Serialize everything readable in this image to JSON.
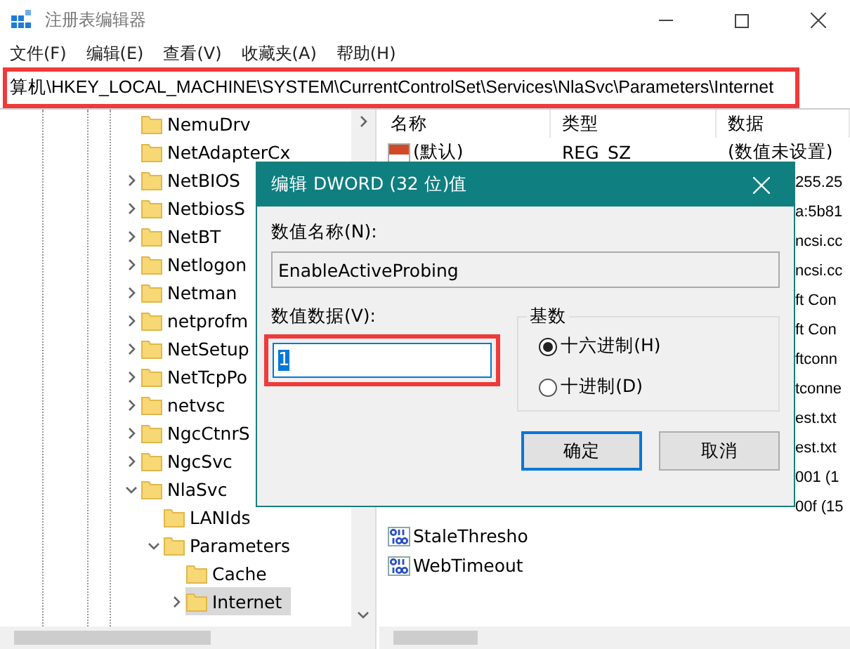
{
  "window": {
    "title": "注册表编辑器"
  },
  "menu": [
    "文件(F)",
    "编辑(E)",
    "查看(V)",
    "收藏夹(A)",
    "帮助(H)"
  ],
  "address": "算机\\HKEY_LOCAL_MACHINE\\SYSTEM\\CurrentControlSet\\Services\\NlaSvc\\Parameters\\Internet",
  "tree": [
    {
      "label": "NemuDrv",
      "kind": "leaf",
      "selected": false
    },
    {
      "label": "NetAdapterCx",
      "kind": "leaf",
      "selected": false
    },
    {
      "label": "NetBIOS",
      "kind": "branch",
      "expanded": false,
      "selected": false
    },
    {
      "label": "NetbiosS",
      "kind": "branch",
      "expanded": false,
      "selected": false
    },
    {
      "label": "NetBT",
      "kind": "branch",
      "expanded": false,
      "selected": false
    },
    {
      "label": "Netlogon",
      "kind": "branch",
      "expanded": false,
      "selected": false
    },
    {
      "label": "Netman",
      "kind": "branch",
      "expanded": false,
      "selected": false
    },
    {
      "label": "netprofm",
      "kind": "branch",
      "expanded": false,
      "selected": false
    },
    {
      "label": "NetSetup",
      "kind": "branch",
      "expanded": false,
      "selected": false
    },
    {
      "label": "NetTcpPo",
      "kind": "branch",
      "expanded": false,
      "selected": false
    },
    {
      "label": "netvsc",
      "kind": "branch",
      "expanded": false,
      "selected": false
    },
    {
      "label": "NgcCtnrS",
      "kind": "branch",
      "expanded": false,
      "selected": false
    },
    {
      "label": "NgcSvc",
      "kind": "branch",
      "expanded": false,
      "selected": false
    },
    {
      "label": "NlaSvc",
      "kind": "branch",
      "expanded": true,
      "selected": false,
      "children": [
        {
          "label": "LANIds",
          "kind": "leaf",
          "selected": false
        },
        {
          "label": "Parameters",
          "kind": "branch",
          "expanded": true,
          "selected": false,
          "children": [
            {
              "label": "Cache",
              "kind": "leaf",
              "selected": false
            },
            {
              "label": "Internet",
              "kind": "branch",
              "expanded": false,
              "selected": true
            }
          ]
        }
      ]
    }
  ],
  "columns": [
    "名称",
    "类型",
    "数据"
  ],
  "values": [
    {
      "kind": "string",
      "name": "(默认)",
      "type": "REG_SZ",
      "data": "(数值未设置)"
    },
    {
      "kind": "partial",
      "data": "255.25"
    },
    {
      "kind": "partial",
      "data": "a:5b81"
    },
    {
      "kind": "partial",
      "data": "ncsi.cc"
    },
    {
      "kind": "partial",
      "data": "ncsi.cc"
    },
    {
      "kind": "partial",
      "data": "ft Con"
    },
    {
      "kind": "partial",
      "data": "ft Con"
    },
    {
      "kind": "partial",
      "data": "ftconn"
    },
    {
      "kind": "partial",
      "data": "tconne"
    },
    {
      "kind": "partial",
      "data": "est.txt"
    },
    {
      "kind": "partial",
      "data": "est.txt"
    },
    {
      "kind": "partial",
      "data": "001 (1"
    },
    {
      "kind": "partial",
      "data": "00f (15"
    },
    {
      "kind": "binary",
      "name": "StaleThresho"
    },
    {
      "kind": "binary",
      "name": "WebTimeout"
    }
  ],
  "dialog": {
    "title": "编辑 DWORD (32 位)值",
    "name_label": "数值名称(N):",
    "name_value": "EnableActiveProbing",
    "data_label": "数值数据(V):",
    "data_value": "1",
    "base_label": "基数",
    "radios": [
      {
        "label": "十六进制(H)",
        "selected": true
      },
      {
        "label": "十进制(D)",
        "selected": false
      }
    ],
    "buttons": [
      {
        "label": "确定",
        "focused": true
      },
      {
        "label": "取消",
        "focused": false
      }
    ]
  }
}
